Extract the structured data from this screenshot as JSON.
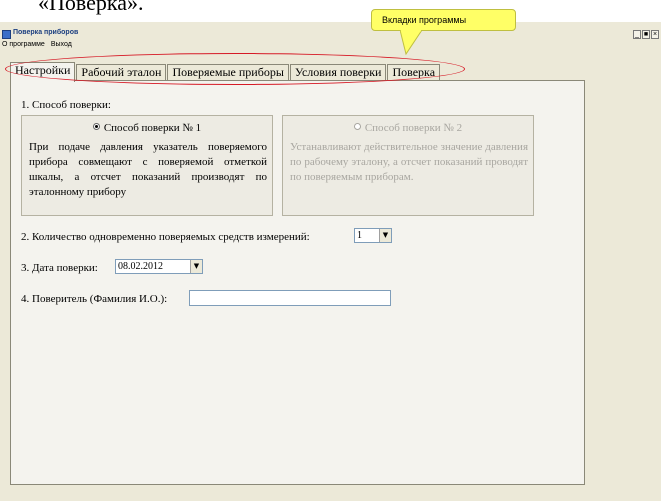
{
  "document": {
    "heading_fragment": "«Поверка»."
  },
  "window": {
    "title": "Поверка приборов",
    "controls": [
      "_",
      "■",
      "×"
    ]
  },
  "menu": [
    "О программе",
    "Выход"
  ],
  "tabs": [
    {
      "label": "Настройки",
      "active": true
    },
    {
      "label": "Рабочий эталон",
      "active": false
    },
    {
      "label": "Поверяемые приборы",
      "active": false
    },
    {
      "label": "Условия поверки",
      "active": false
    },
    {
      "label": "Поверка",
      "active": false
    }
  ],
  "callout": {
    "text": "Вкладки программы"
  },
  "settings": {
    "method_label": "1. Способ поверки:",
    "method1": {
      "title": "Способ поверки № 1",
      "text": "При подаче давления указатель поверяемого прибора совмещают с поверяемой отметкой шкалы, а отсчет показаний производят по эталонному прибору",
      "selected": true
    },
    "method2": {
      "title": "Способ поверки № 2",
      "text": "Устанавливают действительное значение давления по рабочему эталону, а отсчет показаний проводят по поверяемым приборам.",
      "selected": false
    },
    "count_label": "2. Количество одновременно поверяемых средств измерений:",
    "count_value": "1",
    "date_label": "3. Дата поверки:",
    "date_value": "08.02.2012",
    "verifier_label": "4. Поверитель (Фамилия И.О.):",
    "verifier_value": ""
  },
  "colors": {
    "ellipse": "#d61a26",
    "callout_fill": "#ffff66",
    "window_bg": "#ece9d8"
  }
}
